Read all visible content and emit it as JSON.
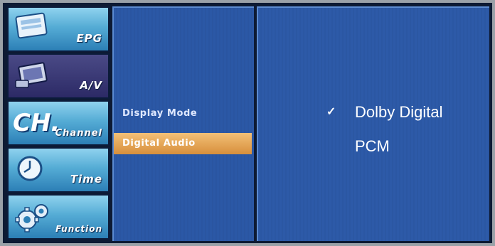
{
  "sidebar": {
    "items": [
      {
        "label": "EPG",
        "icon": "epg-icon"
      },
      {
        "label": "A/V",
        "icon": "av-icon"
      },
      {
        "label": "Channel",
        "icon": "ch-icon",
        "icon_text": "CH."
      },
      {
        "label": "Time",
        "icon": "clock-icon"
      },
      {
        "label": "Function",
        "icon": "gear-icon"
      }
    ],
    "active_index": 1
  },
  "menu": {
    "items": [
      {
        "label": "Display Mode"
      },
      {
        "label": "Digital Audio"
      }
    ],
    "selected_index": 1
  },
  "options": {
    "items": [
      {
        "label": "Dolby Digital",
        "checked": true,
        "check_mark": "✓"
      },
      {
        "label": "PCM",
        "checked": false
      }
    ]
  },
  "colors": {
    "menu_highlight": "#e0a050",
    "panel_blue": "#2b58a6",
    "sidebar_blue": "#55acd5",
    "sidebar_active": "#2c2a66"
  }
}
